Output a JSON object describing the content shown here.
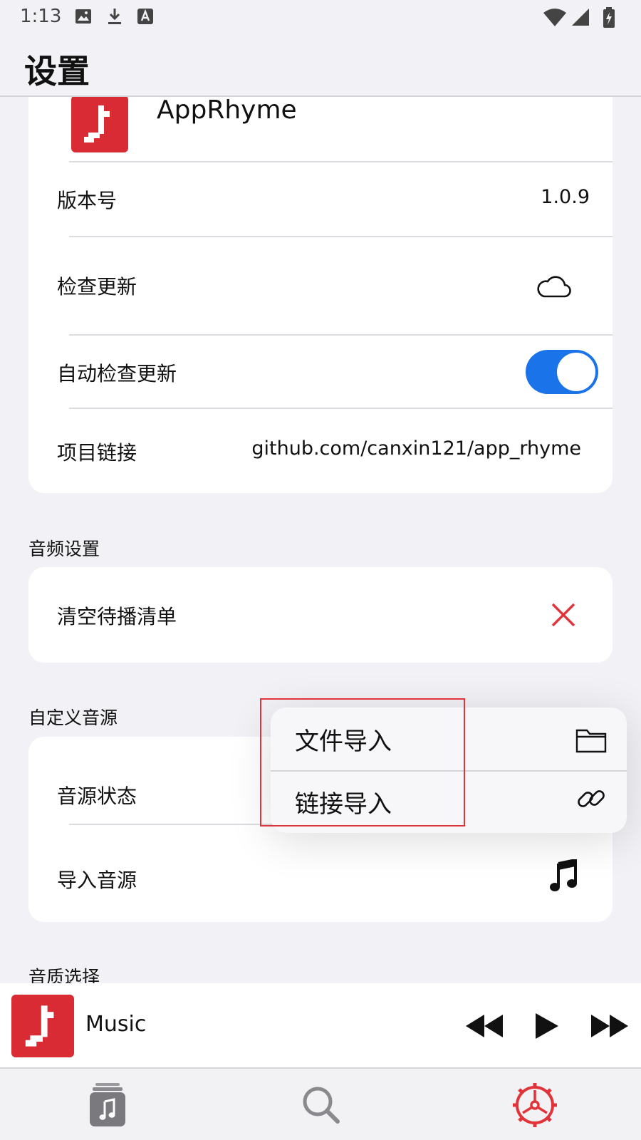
{
  "status_bar": {
    "time": "1:13",
    "icons": [
      "image-icon",
      "download-icon",
      "font-icon",
      "wifi-icon",
      "signal-icon",
      "battery-icon"
    ]
  },
  "header": {
    "title": "设置"
  },
  "about_card": {
    "app_name": "AppRhyme",
    "version_label": "版本号",
    "version_value": "1.0.9",
    "check_update_label": "检查更新",
    "check_update_icon": "cloud-icon",
    "auto_check_label": "自动检查更新",
    "auto_check_enabled": true,
    "project_link_label": "项目链接",
    "project_link_value": "github.com/canxin121/app_rhyme"
  },
  "audio_settings": {
    "section_label": "音频设置",
    "clear_queue_label": "清空待播清单",
    "clear_queue_icon": "close-icon"
  },
  "custom_source": {
    "section_label": "自定义音源",
    "source_status_label": "音源状态",
    "import_source_label": "导入音源",
    "import_source_icon": "music-note-icon"
  },
  "quality": {
    "section_label": "音质选择"
  },
  "import_menu": {
    "items": [
      {
        "label": "文件导入",
        "icon": "folder-icon"
      },
      {
        "label": "链接导入",
        "icon": "link-icon"
      }
    ]
  },
  "mini_player": {
    "title": "Music",
    "controls": [
      "rewind-icon",
      "play-icon",
      "fast-forward-icon"
    ]
  },
  "bottom_nav": {
    "tabs": [
      "library-icon",
      "search-icon",
      "settings-icon"
    ],
    "active_tab": "settings-icon"
  },
  "colors": {
    "accent_blue": "#1a73e8",
    "brand_red": "#d82b33",
    "close_red": "#e0343a",
    "background": "#f2f2f6"
  }
}
